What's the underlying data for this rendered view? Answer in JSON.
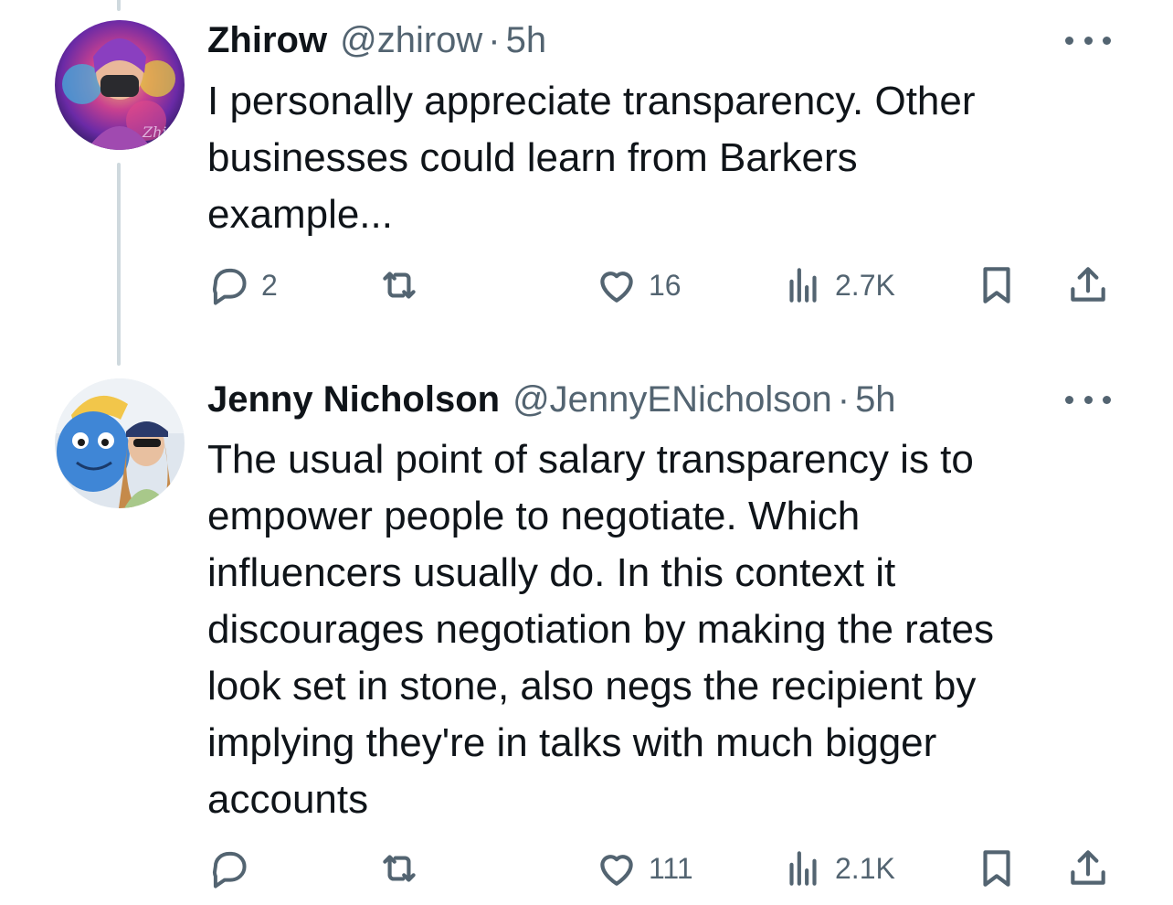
{
  "tweets": [
    {
      "name": "Zhirow",
      "handle": "@zhirow",
      "separator": "·",
      "time": "5h",
      "text": "I personally appreciate transparency. Other\nbusinesses could learn from Barkers\nexample...",
      "stats": {
        "replies": "2",
        "retweets": "",
        "likes": "16",
        "views": "2.7K"
      },
      "avatar_watermark": "Zhirow"
    },
    {
      "name": "Jenny Nicholson",
      "handle": "@JennyENicholson",
      "separator": "·",
      "time": "5h",
      "text": "The usual point of salary transparency is to\nempower people to negotiate. Which\ninfluencers usually do. In this context it\ndiscourages negotiation by making the rates\nlook set in stone, also negs the recipient by\nimplying they're in talks with much bigger\naccounts",
      "stats": {
        "replies": "",
        "retweets": "",
        "likes": "111",
        "views": "2.1K"
      }
    }
  ],
  "colors": {
    "text": "#0f1419",
    "secondary": "#536471",
    "thread_line": "#cfd9de"
  },
  "icons": [
    "reply-icon",
    "retweet-icon",
    "like-icon",
    "views-icon",
    "bookmark-icon",
    "share-icon",
    "more-icon"
  ]
}
